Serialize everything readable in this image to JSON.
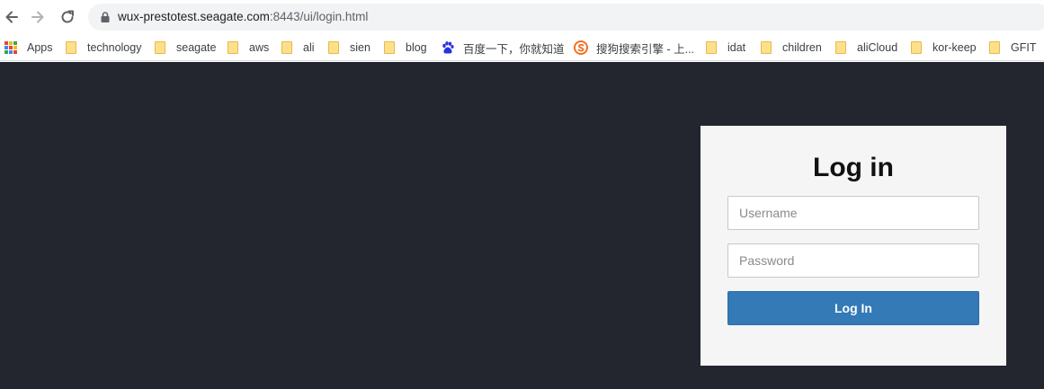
{
  "browser": {
    "url_host": "wux-prestotest.seagate.com",
    "url_path": ":8443/ui/login.html",
    "bookmarks": [
      {
        "label": "Apps",
        "icon": "apps-grid-icon"
      },
      {
        "label": "technology",
        "icon": "folder-icon"
      },
      {
        "label": "seagate",
        "icon": "folder-icon"
      },
      {
        "label": "aws",
        "icon": "folder-icon"
      },
      {
        "label": "ali",
        "icon": "folder-icon"
      },
      {
        "label": "sien",
        "icon": "folder-icon"
      },
      {
        "label": "blog",
        "icon": "folder-icon"
      },
      {
        "label": "百度一下，你就知道",
        "icon": "baidu-paw-icon"
      },
      {
        "label": "搜狗搜索引擎 - 上...",
        "icon": "sogou-icon"
      },
      {
        "label": "idat",
        "icon": "folder-icon"
      },
      {
        "label": "children",
        "icon": "folder-icon"
      },
      {
        "label": "aliCloud",
        "icon": "folder-icon"
      },
      {
        "label": "kor-keep",
        "icon": "folder-icon"
      },
      {
        "label": "GFIT",
        "icon": "folder-icon"
      }
    ]
  },
  "login": {
    "title": "Log in",
    "username_placeholder": "Username",
    "username_value": "",
    "password_placeholder": "Password",
    "password_value": "",
    "submit_label": "Log In"
  },
  "colors": {
    "page_background": "#23262f",
    "card_background": "#f5f5f5",
    "button_primary": "#337ab7"
  }
}
